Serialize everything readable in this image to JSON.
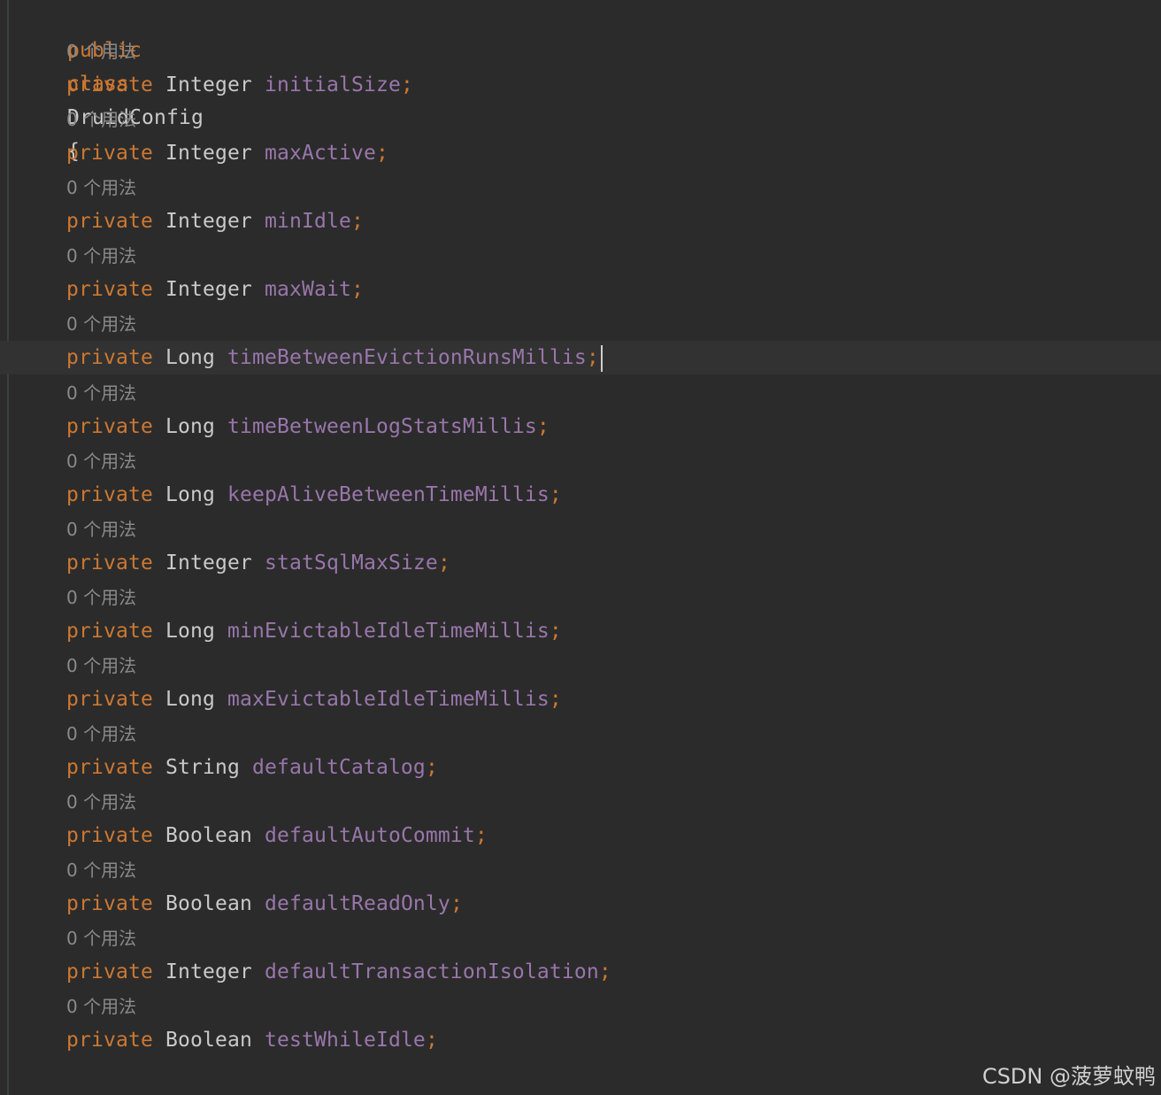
{
  "class_decl": {
    "kw_public": "public",
    "kw_class": "class",
    "name": "DruidConfig",
    "brace": "{"
  },
  "usage_hint": "0 个用法",
  "fields": [
    {
      "modifier": "private",
      "type": "Integer",
      "name": "initialSize"
    },
    {
      "modifier": "private",
      "type": "Integer",
      "name": "maxActive"
    },
    {
      "modifier": "private",
      "type": "Integer",
      "name": "minIdle"
    },
    {
      "modifier": "private",
      "type": "Integer",
      "name": "maxWait"
    },
    {
      "modifier": "private",
      "type": "Long",
      "name": "timeBetweenEvictionRunsMillis"
    },
    {
      "modifier": "private",
      "type": "Long",
      "name": "timeBetweenLogStatsMillis"
    },
    {
      "modifier": "private",
      "type": "Long",
      "name": "keepAliveBetweenTimeMillis"
    },
    {
      "modifier": "private",
      "type": "Integer",
      "name": "statSqlMaxSize"
    },
    {
      "modifier": "private",
      "type": "Long",
      "name": "minEvictableIdleTimeMillis"
    },
    {
      "modifier": "private",
      "type": "Long",
      "name": "maxEvictableIdleTimeMillis"
    },
    {
      "modifier": "private",
      "type": "String",
      "name": "defaultCatalog"
    },
    {
      "modifier": "private",
      "type": "Boolean",
      "name": "defaultAutoCommit"
    },
    {
      "modifier": "private",
      "type": "Boolean",
      "name": "defaultReadOnly"
    },
    {
      "modifier": "private",
      "type": "Integer",
      "name": "defaultTransactionIsolation"
    },
    {
      "modifier": "private",
      "type": "Boolean",
      "name": "testWhileIdle"
    }
  ],
  "semicolon": ";",
  "cursor_field_index": 4,
  "watermark": "CSDN @菠萝蚊鸭",
  "colors": {
    "background": "#2b2b2b",
    "keyword": "#cc7832",
    "field": "#9876aa",
    "type": "#c9c9c9",
    "hint": "#8a8a8a",
    "current_line": "#323232"
  }
}
